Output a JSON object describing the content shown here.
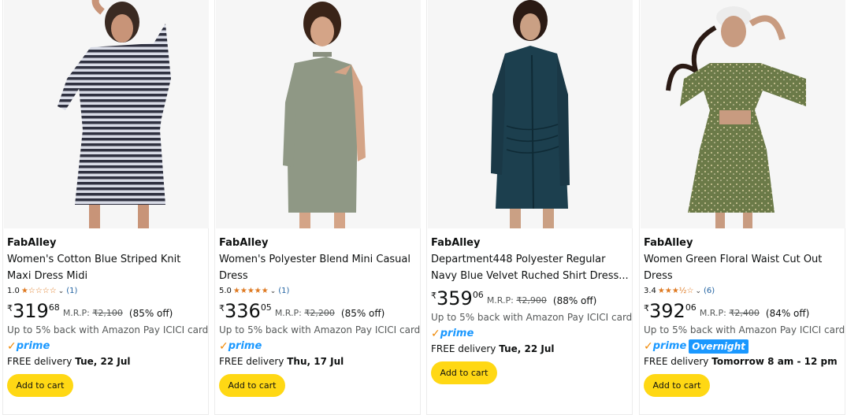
{
  "products": [
    {
      "brand": "FabAlley",
      "title": "Women's Cotton Blue Striped Knit Maxi Dress Midi",
      "rating": "1.0",
      "stars": "★☆☆☆☆",
      "review_count": "(1)",
      "currency": "₹",
      "price_whole": "319",
      "price_fraction": "68",
      "mrp_label": "M.R.P: ",
      "mrp_value": "₹2,100",
      "discount": "(85% off)",
      "cashback": "Up to 5% back with Amazon Pay ICICI card",
      "prime_label": "prime",
      "delivery_prefix": "FREE delivery ",
      "delivery_date": "Tue, 22 Jul",
      "cart_label": "Add to cart"
    },
    {
      "brand": "FabAlley",
      "title": "Women's Polyester Blend Mini Casual Dress",
      "rating": "5.0",
      "stars": "★★★★★",
      "review_count": "(1)",
      "currency": "₹",
      "price_whole": "336",
      "price_fraction": "05",
      "mrp_label": "M.R.P: ",
      "mrp_value": "₹2,200",
      "discount": "(85% off)",
      "cashback": "Up to 5% back with Amazon Pay ICICI card",
      "prime_label": "prime",
      "delivery_prefix": "FREE delivery ",
      "delivery_date": "Thu, 17 Jul",
      "cart_label": "Add to cart"
    },
    {
      "brand": "FabAlley",
      "title": "Department448 Polyester Regular Navy Blue Velvet Ruched Shirt Dress...",
      "currency": "₹",
      "price_whole": "359",
      "price_fraction": "06",
      "mrp_label": "M.R.P: ",
      "mrp_value": "₹2,900",
      "discount": "(88% off)",
      "cashback": "Up to 5% back with Amazon Pay ICICI card",
      "prime_label": "prime",
      "delivery_prefix": "FREE delivery ",
      "delivery_date": "Tue, 22 Jul",
      "cart_label": "Add to cart"
    },
    {
      "brand": "FabAlley",
      "title": "Women Green Floral Waist Cut Out Dress",
      "rating": "3.4",
      "stars": "★★★½☆",
      "review_count": "(6)",
      "currency": "₹",
      "price_whole": "392",
      "price_fraction": "06",
      "mrp_label": "M.R.P: ",
      "mrp_value": "₹2,400",
      "discount": "(84% off)",
      "cashback": "Up to 5% back with Amazon Pay ICICI card",
      "prime_label": "prime",
      "overnight_label": "Overnight",
      "delivery_prefix": "FREE delivery ",
      "delivery_date": "Tomorrow 8 am - 12 pm",
      "cart_label": "Add to cart"
    }
  ],
  "colors": {
    "star": "#de7921",
    "prime_blue": "#1a98ff",
    "prime_check": "#f08804",
    "cart_button": "#ffd814",
    "link": "#2162a1"
  },
  "icons": {
    "star": "star-icon",
    "chevron": "chevron-down-icon",
    "prime": "prime-check-icon"
  }
}
